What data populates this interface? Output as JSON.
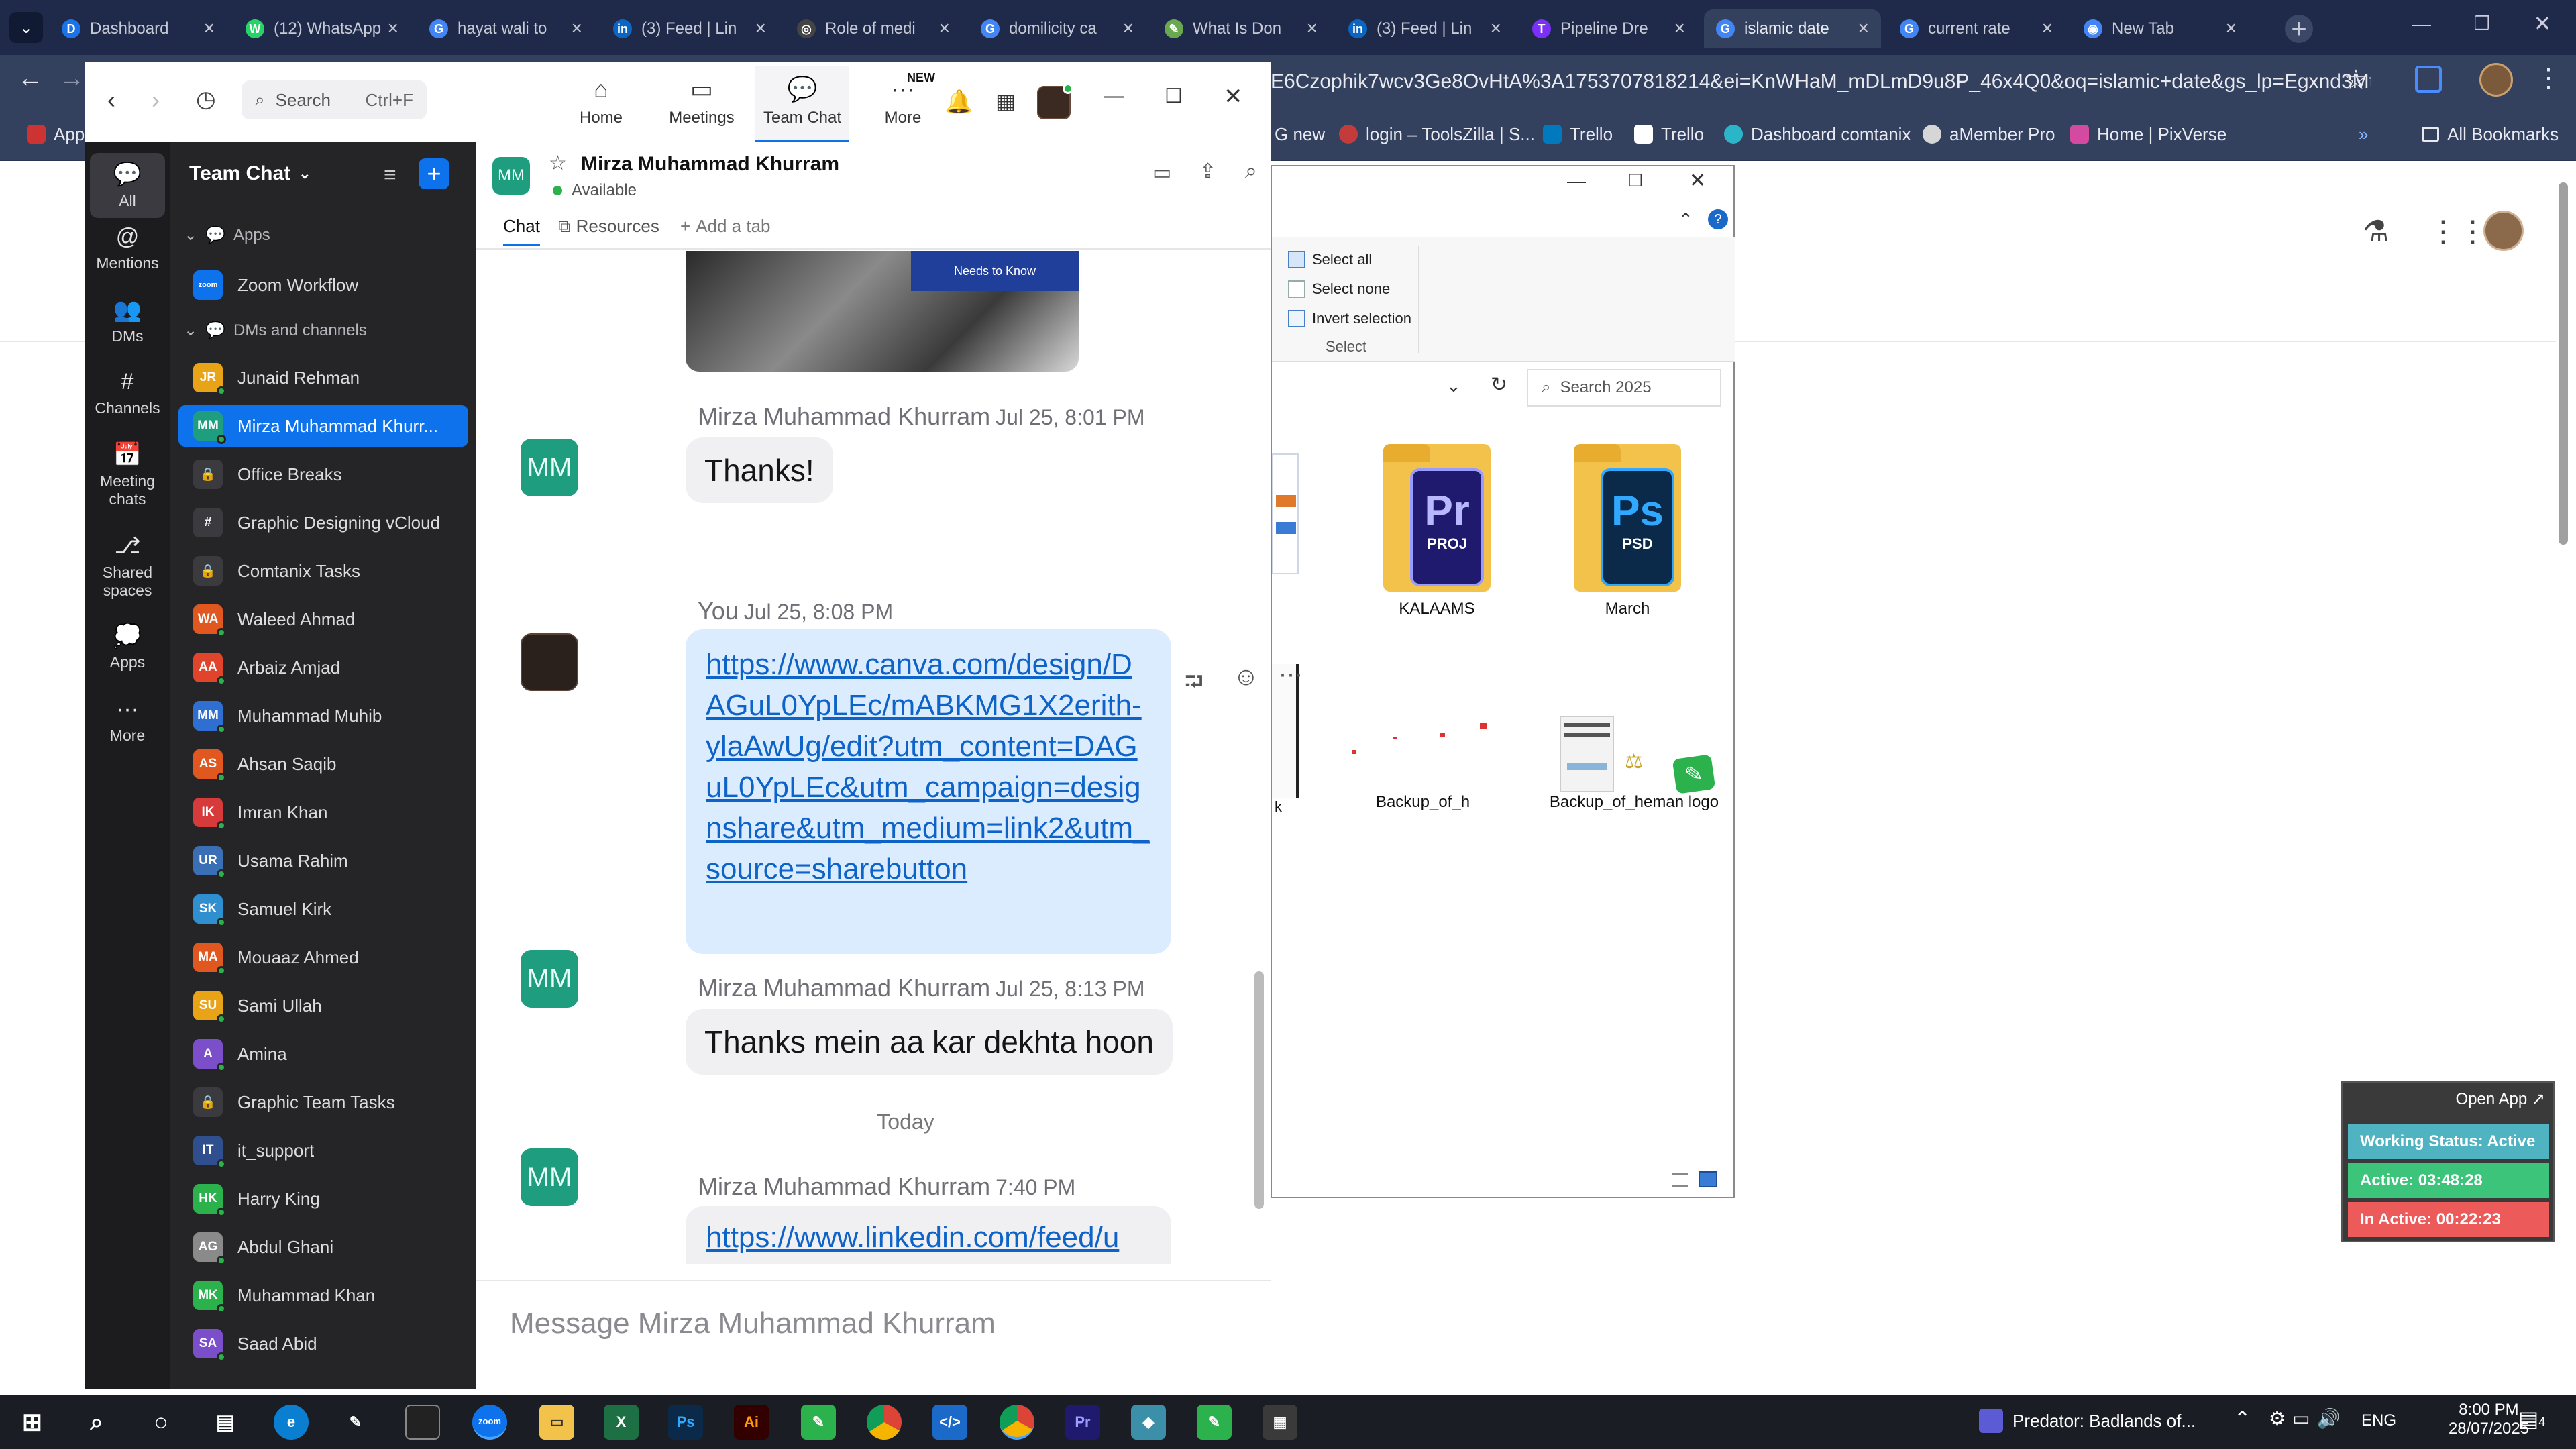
{
  "browser": {
    "tabs": [
      {
        "label": "Dashboard",
        "color": "#1a73e8",
        "glyph": "D"
      },
      {
        "label": "(12) WhatsApp",
        "color": "#25d366",
        "glyph": "W"
      },
      {
        "label": "hayat wali to",
        "color": "#4285f4",
        "glyph": "G"
      },
      {
        "label": "(3) Feed | Lin",
        "color": "#0a66c2",
        "glyph": "in"
      },
      {
        "label": "Role of medi",
        "color": "#444444",
        "glyph": "◎"
      },
      {
        "label": "domilicity ca",
        "color": "#4285f4",
        "glyph": "G"
      },
      {
        "label": "What Is Don",
        "color": "#6aa84f",
        "glyph": "✎"
      },
      {
        "label": "(3) Feed | Lin",
        "color": "#0a66c2",
        "glyph": "in"
      },
      {
        "label": "Pipeline Dre",
        "color": "#7b2ff7",
        "glyph": "T"
      },
      {
        "label": "islamic date",
        "color": "#4285f4",
        "glyph": "G"
      },
      {
        "label": "current rate",
        "color": "#4285f4",
        "glyph": "G"
      },
      {
        "label": "New Tab",
        "color": "#4285f4",
        "glyph": "◉"
      }
    ],
    "url": "E6Czophik7wcv3Ge8OvHtA%3A1753707818214&ei=KnWHaM_mDLmD9u8P_46x4Q0&oq=islamic+date&gs_lp=Egxnd3Mtd2l...",
    "bookmarks": [
      {
        "label": "App"
      },
      {
        "label": "G new"
      },
      {
        "label": "login – ToolsZilla | S..."
      },
      {
        "label": "Trello"
      },
      {
        "label": "Trello"
      },
      {
        "label": "Dashboard comtanix"
      },
      {
        "label": "aMember Pro"
      },
      {
        "label": "Home | PixVerse"
      },
      {
        "label": "»"
      },
      {
        "label": "All Bookmarks"
      }
    ]
  },
  "explorer": {
    "select_all": "Select all",
    "select_none": "Select none",
    "invert_selection": "Invert selection",
    "group_label": "Select",
    "search_placeholder": "Search 2025",
    "files": [
      {
        "name": "KALAAMS",
        "badge": "Pr",
        "sub": "PROJ",
        "color": "#1f1a6e",
        "accent": "#9a9bff"
      },
      {
        "name": "March",
        "badge": "Ps",
        "sub": "PSD",
        "color": "#0b2a4a",
        "accent": "#31a8ff"
      }
    ],
    "file_row2": [
      "Backup_of_h",
      "Backup_of_heman logo"
    ],
    "partial_label": "k"
  },
  "zoom": {
    "search_placeholder": "Search",
    "search_shortcut": "Ctrl+F",
    "nav": [
      {
        "label": "Home",
        "icon": "home-icon",
        "glyph": "⌂"
      },
      {
        "label": "Meetings",
        "icon": "video-icon",
        "glyph": "▭"
      },
      {
        "label": "Team Chat",
        "icon": "chat-icon",
        "glyph": "💬"
      },
      {
        "label": "More",
        "icon": "more-icon",
        "glyph": "⋯",
        "badge": "NEW"
      }
    ],
    "rail": [
      {
        "label": "All",
        "glyph": "💬"
      },
      {
        "label": "Mentions",
        "glyph": "@"
      },
      {
        "label": "DMs",
        "glyph": "👥"
      },
      {
        "label": "Channels",
        "glyph": "#"
      },
      {
        "label": "Meeting\nchats",
        "glyph": "📅"
      },
      {
        "label": "Shared\nspaces",
        "glyph": "⎇"
      },
      {
        "label": "Apps",
        "glyph": "💭"
      },
      {
        "label": "More",
        "glyph": "···"
      }
    ],
    "side_title": "Team Chat",
    "section_apps": "Apps",
    "section_dms": "DMs and channels",
    "apps": [
      {
        "name": "Zoom Workflow",
        "initials": "zoom",
        "color": "#0e72ed"
      }
    ],
    "contacts": [
      {
        "name": "Junaid Rehman",
        "initials": "JR",
        "color": "#e8a317"
      },
      {
        "name": "Mirza Muhammad Khurr...",
        "initials": "MM",
        "color": "#1f9e7f",
        "active": true
      },
      {
        "name": "Office Breaks",
        "initials": "🔒",
        "color": "#3a3a3f"
      },
      {
        "name": "Graphic Designing vCloud",
        "initials": "#",
        "color": "#3a3a3f"
      },
      {
        "name": "Comtanix Tasks",
        "initials": "🔒",
        "color": "#3a3a3f"
      },
      {
        "name": "Waleed Ahmad",
        "initials": "WA",
        "color": "#e0581f"
      },
      {
        "name": "Arbaiz Amjad",
        "initials": "AA",
        "color": "#e0452b"
      },
      {
        "name": "Muhammad Muhib",
        "initials": "MM",
        "color": "#2f6fd1"
      },
      {
        "name": "Ahsan Saqib",
        "initials": "AS",
        "color": "#e0581f"
      },
      {
        "name": "Imran Khan",
        "initials": "IK",
        "color": "#d63a3a"
      },
      {
        "name": "Usama Rahim",
        "initials": "UR",
        "color": "#3a6fb5"
      },
      {
        "name": "Samuel Kirk",
        "initials": "SK",
        "color": "#2f8fcf"
      },
      {
        "name": "Mouaaz Ahmed",
        "initials": "MA",
        "color": "#e0581f"
      },
      {
        "name": "Sami Ullah",
        "initials": "SU",
        "color": "#e8a317"
      },
      {
        "name": "Amina",
        "initials": "A",
        "color": "#7a4fc9"
      },
      {
        "name": "Graphic Team Tasks",
        "initials": "🔒",
        "color": "#3a3a3f"
      },
      {
        "name": "it_support",
        "initials": "IT",
        "color": "#2f4f8f"
      },
      {
        "name": "Harry King",
        "initials": "HK",
        "color": "#2bb24c"
      },
      {
        "name": "Abdul Ghani",
        "initials": "AG",
        "color": "#8a8a8a"
      },
      {
        "name": "Muhammad Khan",
        "initials": "MK",
        "color": "#2bb24c"
      },
      {
        "name": "Saad Abid",
        "initials": "SA",
        "color": "#7a4fc9"
      }
    ],
    "chat": {
      "name": "Mirza Muhammad Khurram",
      "initials": "MM",
      "status": "Available",
      "tabs": [
        "Chat",
        "Resources",
        "Add a tab"
      ],
      "image_caption": "Needs to Know",
      "messages": [
        {
          "sender": "Mirza Muhammad Khurram",
          "time": "Jul 25, 8:01 PM",
          "text": "Thanks!"
        },
        {
          "sender": "You",
          "time": "Jul 25, 8:08 PM",
          "link": "https://www.canva.com/design/DAGuL0YpLEc/mABKMG1X2erith-ylaAwUg/edit?utm_content=DAGuL0YpLEc&utm_campaign=designshare&utm_medium=link2&utm_source=sharebutton"
        },
        {
          "sender": "Mirza Muhammad Khurram",
          "time": "Jul 25, 8:13 PM",
          "text": "Thanks mein aa kar dekhta hoon"
        },
        {
          "sender": "Mirza Muhammad Khurram",
          "time": "7:40 PM",
          "link": "https://www.linkedin.com/feed/u"
        }
      ],
      "day_separator": "Today",
      "composer_placeholder": "Message Mirza Muhammad Khurram"
    }
  },
  "widget": {
    "open_app": "Open App ↗",
    "working_status": "Working Status: Active",
    "active": "Active: 03:48:28",
    "inactive": "In Active: 00:22:23"
  },
  "taskbar": {
    "media": "Predator: Badlands of...",
    "lang": "ENG",
    "time": "8:00 PM",
    "date": "28/07/2025",
    "notif_count": "4"
  }
}
